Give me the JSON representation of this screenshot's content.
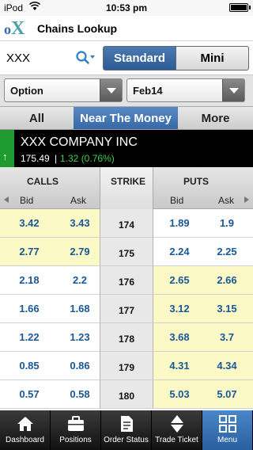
{
  "status_bar": {
    "carrier": "iPod",
    "time": "10:53 pm"
  },
  "header": {
    "logo_o": "o",
    "logo_x": "X",
    "title": "Chains Lookup"
  },
  "search": {
    "symbol": "XXX"
  },
  "view_toggle": {
    "standard": "Standard",
    "mini": "Mini",
    "selected": "Standard"
  },
  "dropdowns": {
    "type": "Option",
    "expiry": "Feb14"
  },
  "filter_tabs": {
    "all": "All",
    "near": "Near The Money",
    "more": "More",
    "selected": "Near The Money"
  },
  "quote": {
    "company": "XXX COMPANY INC",
    "price": "175.49",
    "separator": "|",
    "change": "1.32 (0.76%)",
    "trend": "up"
  },
  "chain_header": {
    "calls": "CALLS",
    "strike": "STRIKE",
    "puts": "PUTS",
    "bid": "Bid",
    "ask": "Ask"
  },
  "chain": {
    "rows": [
      {
        "call_bid": "3.42",
        "call_ask": "3.43",
        "strike": "174",
        "put_bid": "1.89",
        "put_ask": "1.9",
        "call_itm": true,
        "put_itm": false
      },
      {
        "call_bid": "2.77",
        "call_ask": "2.79",
        "strike": "175",
        "put_bid": "2.24",
        "put_ask": "2.25",
        "call_itm": true,
        "put_itm": false
      },
      {
        "call_bid": "2.18",
        "call_ask": "2.2",
        "strike": "176",
        "put_bid": "2.65",
        "put_ask": "2.66",
        "call_itm": false,
        "put_itm": true
      },
      {
        "call_bid": "1.66",
        "call_ask": "1.68",
        "strike": "177",
        "put_bid": "3.12",
        "put_ask": "3.15",
        "call_itm": false,
        "put_itm": true
      },
      {
        "call_bid": "1.22",
        "call_ask": "1.23",
        "strike": "178",
        "put_bid": "3.68",
        "put_ask": "3.7",
        "call_itm": false,
        "put_itm": true
      },
      {
        "call_bid": "0.85",
        "call_ask": "0.86",
        "strike": "179",
        "put_bid": "4.31",
        "put_ask": "4.34",
        "call_itm": false,
        "put_itm": true
      },
      {
        "call_bid": "0.57",
        "call_ask": "0.58",
        "strike": "180",
        "put_bid": "5.03",
        "put_ask": "5.07",
        "call_itm": false,
        "put_itm": true
      }
    ]
  },
  "tabbar": {
    "items": [
      {
        "label": "Dashboard",
        "icon": "home-icon"
      },
      {
        "label": "Positions",
        "icon": "briefcase-icon"
      },
      {
        "label": "Order Status",
        "icon": "document-icon"
      },
      {
        "label": "Trade Ticket",
        "icon": "up-down-arrows-icon"
      },
      {
        "label": "Menu",
        "icon": "grid-icon"
      }
    ],
    "active": "Menu"
  },
  "colors": {
    "accent": "#3568a8",
    "itm_highlight": "#fbfac7",
    "positive": "#3fcf4a",
    "trend_up": "#1e9a2e"
  }
}
